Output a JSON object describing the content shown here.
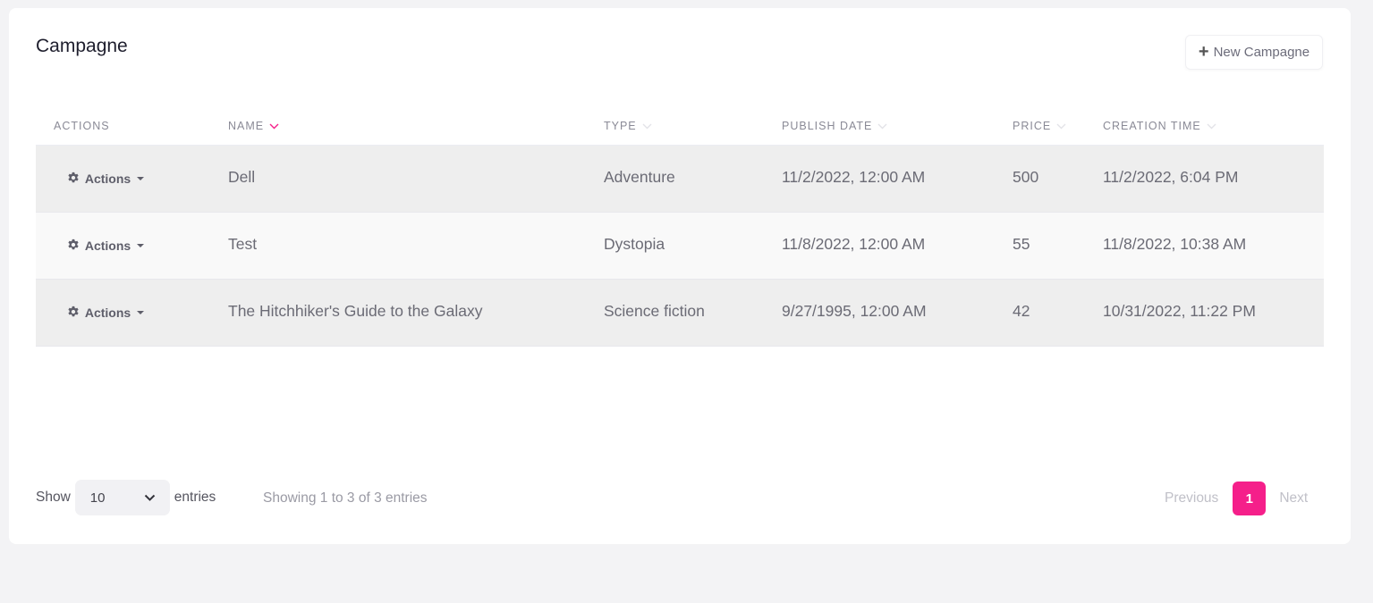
{
  "card": {
    "title": "Campagne",
    "new_button_label": "New Campagne",
    "new_button_icon": "plus-icon"
  },
  "table": {
    "columns": [
      {
        "key": "actions",
        "label": "ACTIONS",
        "sortable": false,
        "sorted": false
      },
      {
        "key": "name",
        "label": "NAME",
        "sortable": true,
        "sorted": true,
        "sort_color": "#f51f8a"
      },
      {
        "key": "type",
        "label": "TYPE",
        "sortable": true,
        "sorted": false
      },
      {
        "key": "publish_date",
        "label": "PUBLISH DATE",
        "sortable": true,
        "sorted": false
      },
      {
        "key": "price",
        "label": "PRICE",
        "sortable": true,
        "sorted": false
      },
      {
        "key": "creation_time",
        "label": "CREATION TIME",
        "sortable": true,
        "sorted": false
      }
    ],
    "rows": [
      {
        "action_label": "Actions",
        "name": "Dell",
        "type": "Adventure",
        "publish_date": "11/2/2022, 12:00 AM",
        "price": "500",
        "creation_time": "11/2/2022, 6:04 PM"
      },
      {
        "action_label": "Actions",
        "name": "Test",
        "type": "Dystopia",
        "publish_date": "11/8/2022, 12:00 AM",
        "price": "55",
        "creation_time": "11/8/2022, 10:38 AM"
      },
      {
        "action_label": "Actions",
        "name": "The Hitchhiker's Guide to the Galaxy",
        "type": "Science fiction",
        "publish_date": "9/27/1995, 12:00 AM",
        "price": "42",
        "creation_time": "10/31/2022, 11:22 PM"
      }
    ]
  },
  "footer": {
    "show_label": "Show",
    "page_size": "10",
    "entries_label": "entries",
    "showing_text": "Showing 1 to 3 of 3 entries",
    "prev_label": "Previous",
    "current_page": "1",
    "next_label": "Next"
  },
  "colors": {
    "accent": "#f51f8a",
    "row_odd": "#eeeeee",
    "row_even": "#f9f9f9"
  }
}
